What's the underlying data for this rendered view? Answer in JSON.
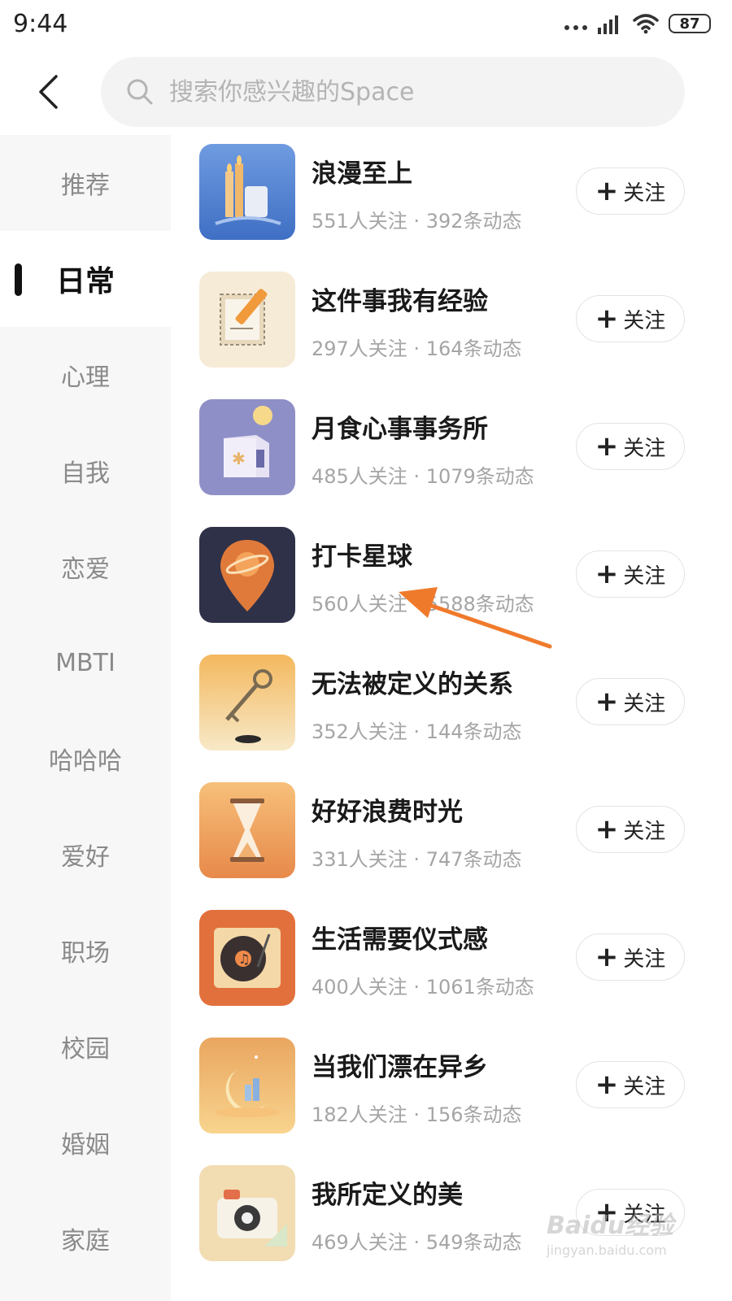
{
  "status_bar": {
    "time": "9:44",
    "battery": "87"
  },
  "search": {
    "placeholder": "搜索你感兴趣的Space"
  },
  "sidebar": {
    "items": [
      {
        "label": "推荐"
      },
      {
        "label": "日常",
        "active": true
      },
      {
        "label": "心理"
      },
      {
        "label": "自我"
      },
      {
        "label": "恋爱"
      },
      {
        "label": "MBTI"
      },
      {
        "label": "哈哈哈"
      },
      {
        "label": "爱好"
      },
      {
        "label": "职场"
      },
      {
        "label": "校园"
      },
      {
        "label": "婚姻"
      },
      {
        "label": "家庭"
      }
    ]
  },
  "list": {
    "follow_label": "关注",
    "spaces": [
      {
        "title": "浪漫至上",
        "meta": "551人关注 · 392条动态",
        "icon": "candles-icon"
      },
      {
        "title": "这件事我有经验",
        "meta": "297人关注 · 164条动态",
        "icon": "pencil-paper-icon"
      },
      {
        "title": "月食心事事务所",
        "meta": "485人关注 · 1079条动态",
        "icon": "moon-house-icon"
      },
      {
        "title": "打卡星球",
        "meta": "560人关注 · 5588条动态",
        "icon": "planet-pin-icon"
      },
      {
        "title": "无法被定义的关系",
        "meta": "352人关注 · 144条动态",
        "icon": "key-icon"
      },
      {
        "title": "好好浪费时光",
        "meta": "331人关注 · 747条动态",
        "icon": "hourglass-icon"
      },
      {
        "title": "生活需要仪式感",
        "meta": "400人关注 · 1061条动态",
        "icon": "record-player-icon"
      },
      {
        "title": "当我们漂在异乡",
        "meta": "182人关注 · 156条动态",
        "icon": "crescent-city-icon"
      },
      {
        "title": "我所定义的美",
        "meta": "469人关注 · 549条动态",
        "icon": "camera-icon"
      }
    ]
  },
  "watermark": {
    "logo": "Baidu经验",
    "url": "jingyan.baidu.com"
  },
  "colors": {
    "annotation_arrow": "#f07a2c",
    "active_text": "#111111",
    "inactive_text": "#8a8a8a"
  }
}
